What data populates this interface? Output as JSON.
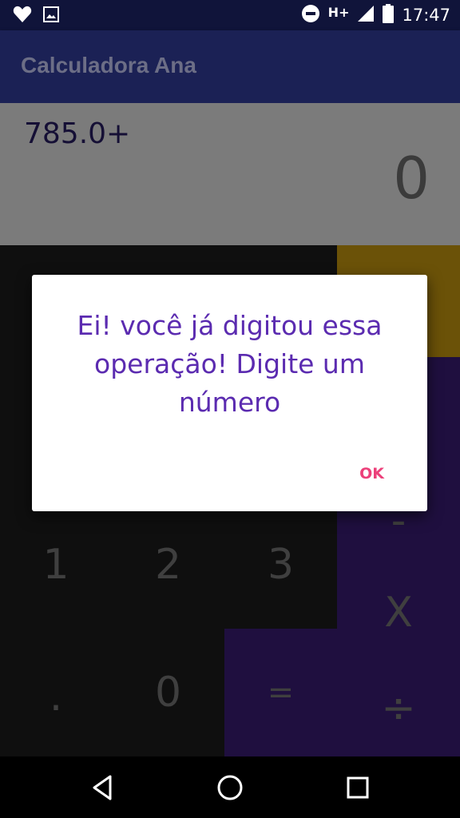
{
  "status_bar": {
    "time": "17:47",
    "network": "H+",
    "icons": [
      "heart-icon",
      "image-icon",
      "do-not-disturb-icon",
      "signal-icon",
      "battery-icon"
    ]
  },
  "app_bar": {
    "title": "Calculadora Ana"
  },
  "display": {
    "expression": "785.0+",
    "result": "0"
  },
  "keypad": {
    "visible_keys": [
      "1",
      "2",
      "3",
      ".",
      "0",
      "=",
      "-",
      "X",
      "÷"
    ]
  },
  "dialog": {
    "message": "Ei! você já digitou essa operação! Digite um número",
    "ok_label": "OK"
  },
  "nav_bar": {
    "icons": [
      "back-icon",
      "home-icon",
      "recents-icon"
    ]
  },
  "colors": {
    "status_bar": "#10143a",
    "app_bar": "#1b2155",
    "dialog_text": "#5b2bb0",
    "dialog_button": "#ec407a",
    "operator_column": "#1f0f3f",
    "delete_key": "#6b5208"
  }
}
